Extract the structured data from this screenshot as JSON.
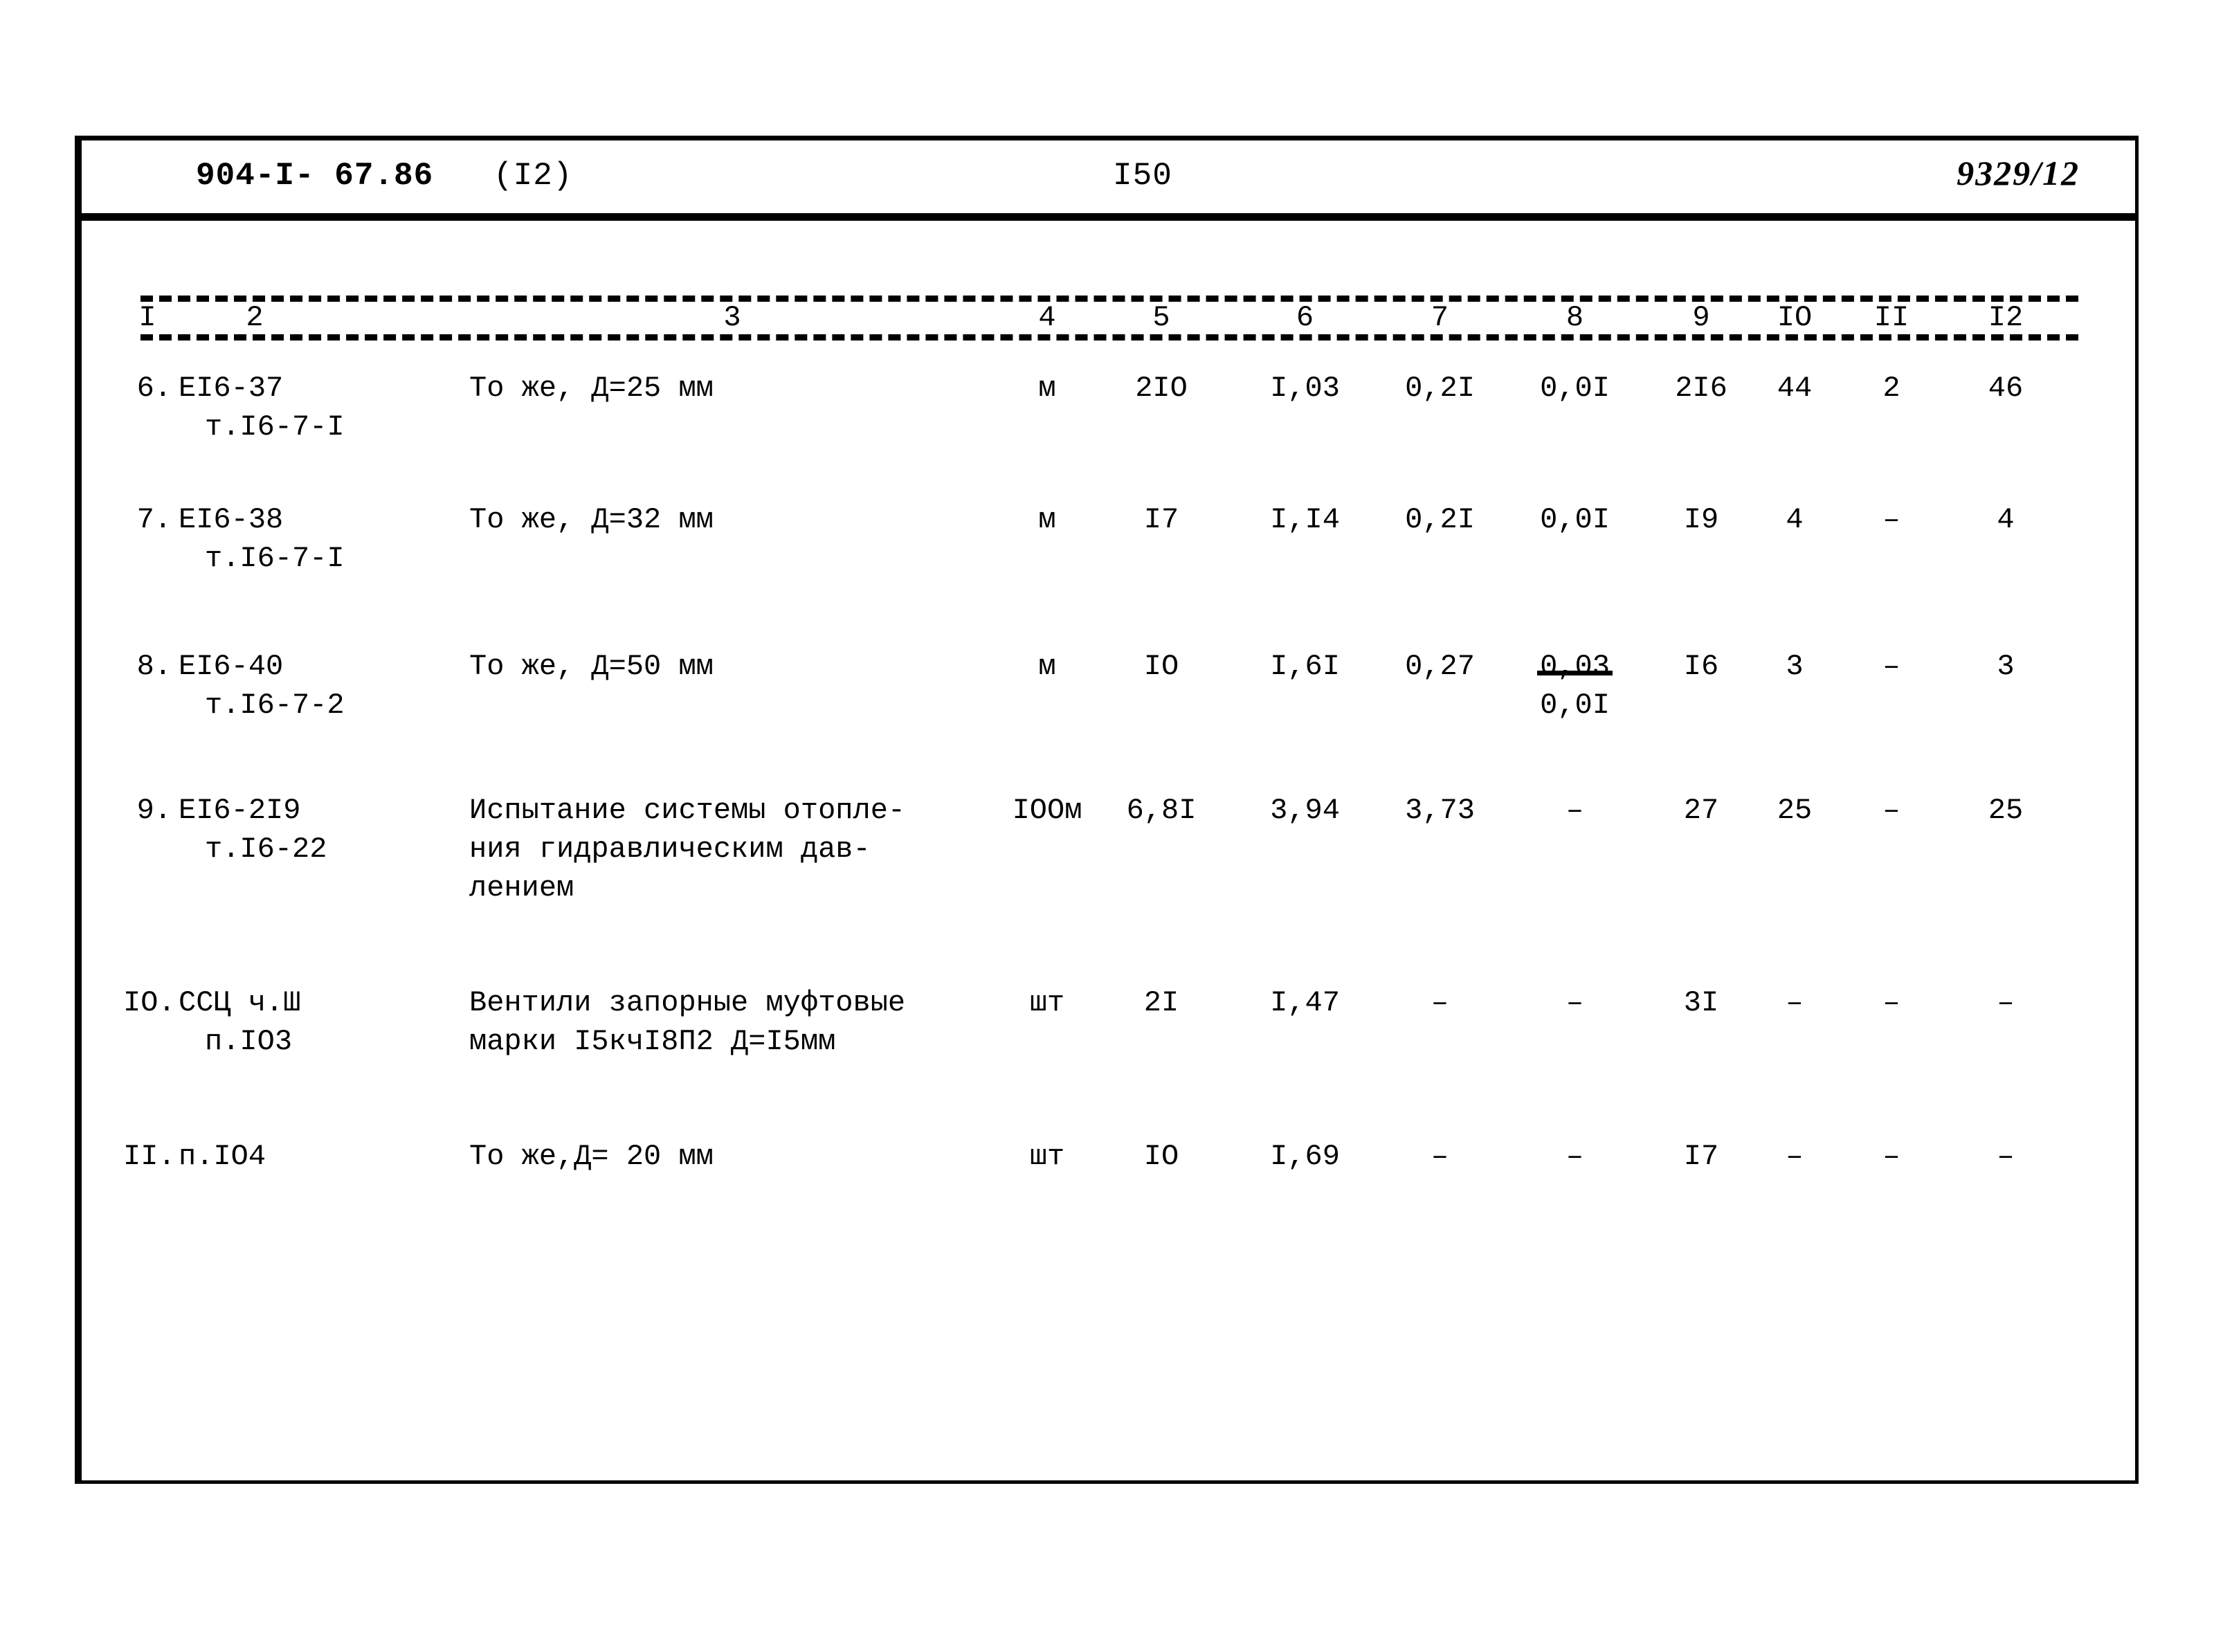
{
  "header": {
    "doc_code": "904-I- 67.86",
    "sheet_variant": "(I2)",
    "page_number": "I50",
    "archive_code": "9329/12"
  },
  "table": {
    "column_numbers": [
      "I",
      "2",
      "3",
      "4",
      "5",
      "6",
      "7",
      "8",
      "9",
      "IO",
      "II",
      "I2"
    ],
    "rows": [
      {
        "index": "6.",
        "code_line1": "ЕI6-37",
        "code_line2": "т.I6-7-I",
        "description": "То  же, Д=25 мм",
        "unit": "м",
        "c5": "2IO",
        "c6": "I,03",
        "c7": "0,2I",
        "c8": "0,0I",
        "c8_sub": "",
        "c9": "2I6",
        "c10": "44",
        "c11": "2",
        "c12": "46"
      },
      {
        "index": "7.",
        "code_line1": "ЕI6-38",
        "code_line2": "т.I6-7-I",
        "description": "То же,  Д=32 мм",
        "unit": "м",
        "c5": "I7",
        "c6": "I,I4",
        "c7": "0,2I",
        "c8": "0,0I",
        "c8_sub": "",
        "c9": "I9",
        "c10": "4",
        "c11": "–",
        "c12": "4"
      },
      {
        "index": "8.",
        "code_line1": "ЕI6-40",
        "code_line2": "т.I6-7-2",
        "description": "То же,  Д=50 мм",
        "unit": "м",
        "c5": "IO",
        "c6": "I,6I",
        "c7": "0,27",
        "c8": "0,03",
        "c8_sub": "0,0I",
        "c9": "I6",
        "c10": "3",
        "c11": "–",
        "c12": "3"
      },
      {
        "index": "9.",
        "code_line1": "ЕI6-2I9",
        "code_line2": "т.I6-22",
        "description": "Испытание системы отопле-\nния  гидравлическим дав-\nлением",
        "unit": "IOOм",
        "c5": "6,8I",
        "c6": "3,94",
        "c7": "3,73",
        "c8": "–",
        "c8_sub": "",
        "c9": "27",
        "c10": "25",
        "c11": "–",
        "c12": "25"
      },
      {
        "index": "IO.",
        "code_line1": "ССЦ ч.Ш",
        "code_line2": "п.IО3",
        "description": "Вентили запорные муфтовые\nмарки I5кчI8П2 Д=I5мм",
        "unit": "шт",
        "c5": "2I",
        "c6": "I,47",
        "c7": "–",
        "c8": "–",
        "c8_sub": "",
        "c9": "3I",
        "c10": "–",
        "c11": "–",
        "c12": "–"
      },
      {
        "index": "II.",
        "code_line1": "п.IО4",
        "code_line2": "",
        "description": "То же,Д= 20 мм",
        "unit": "шт",
        "c5": "IO",
        "c6": "I,69",
        "c7": "–",
        "c8": "–",
        "c8_sub": "",
        "c9": "I7",
        "c10": "–",
        "c11": "–",
        "c12": "–"
      }
    ]
  }
}
